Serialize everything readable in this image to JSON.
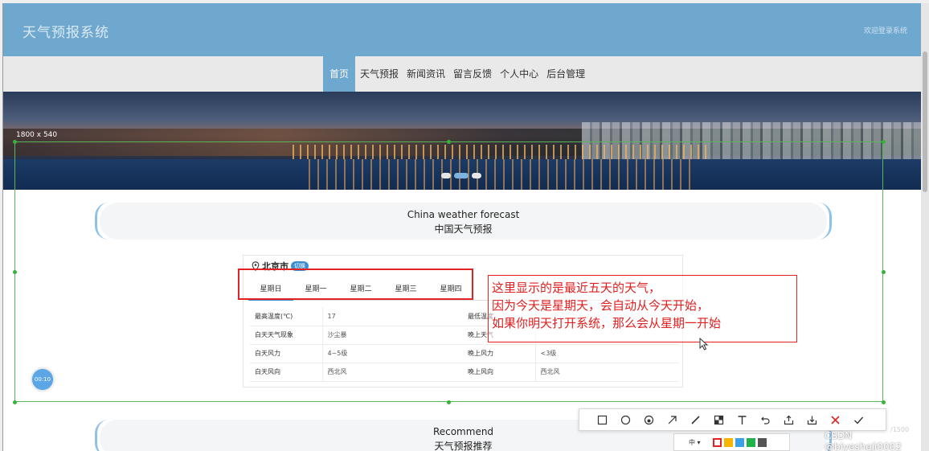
{
  "header": {
    "brand": "天气预报系统",
    "right_text": "欢迎登录系统"
  },
  "nav": {
    "items": [
      {
        "label": "首页",
        "active": true
      },
      {
        "label": "天气预报",
        "active": false
      },
      {
        "label": "新闻资讯",
        "active": false
      },
      {
        "label": "留言反馈",
        "active": false
      },
      {
        "label": "个人中心",
        "active": false
      },
      {
        "label": "后台管理",
        "active": false
      }
    ]
  },
  "banner": {
    "size_label": "1800 x 540",
    "slide_count": 3,
    "active_slide": 2
  },
  "forecast_section": {
    "title_en": "China weather forecast",
    "title_zh": "中国天气预报"
  },
  "weather_widget": {
    "city": "北京市",
    "city_badge": "切换",
    "tabs": [
      {
        "label": "星期日",
        "active": true
      },
      {
        "label": "星期一",
        "active": false
      },
      {
        "label": "星期二",
        "active": false
      },
      {
        "label": "星期三",
        "active": false
      },
      {
        "label": "星期四",
        "active": false
      }
    ],
    "rows": [
      {
        "k1": "最高温度(℃)",
        "v1": "17",
        "k2": "最低温度",
        "v2": ""
      },
      {
        "k1": "白天天气现象",
        "v1": "沙尘暴",
        "k2": "晚上天气",
        "v2": ""
      },
      {
        "k1": "白天风力",
        "v1": "4~5级",
        "k2": "晚上风力",
        "v2": "<3级"
      },
      {
        "k1": "白天风向",
        "v1": "西北风",
        "k2": "晚上风向",
        "v2": "西北风"
      }
    ]
  },
  "annotation": {
    "lines": [
      "这里显示的是最近五天的天气，",
      "因为今天是星期天，会自动从今天开始，",
      "如果你明天打开系统，那么会从星期一开始"
    ]
  },
  "recommend_section": {
    "title_en": "Recommend",
    "title_zh": "天气预报推荐"
  },
  "timer": "00:10",
  "screenshot_toolbar": {
    "tools": [
      "rectangle-icon",
      "ellipse-icon",
      "marker-icon",
      "arrow-icon",
      "pen-icon",
      "mosaic-icon",
      "text-icon",
      "undo-icon",
      "share-icon",
      "download-icon",
      "cancel-icon",
      "confirm-icon"
    ],
    "size_option": "中",
    "colors": [
      "#e32323",
      "#f7b500",
      "#3aa0e8",
      "#22b24c",
      "#555555"
    ],
    "selected_color": "#e32323"
  },
  "watermark": "CSDN @biyesheji0002",
  "watermark_faint": "/1500"
}
